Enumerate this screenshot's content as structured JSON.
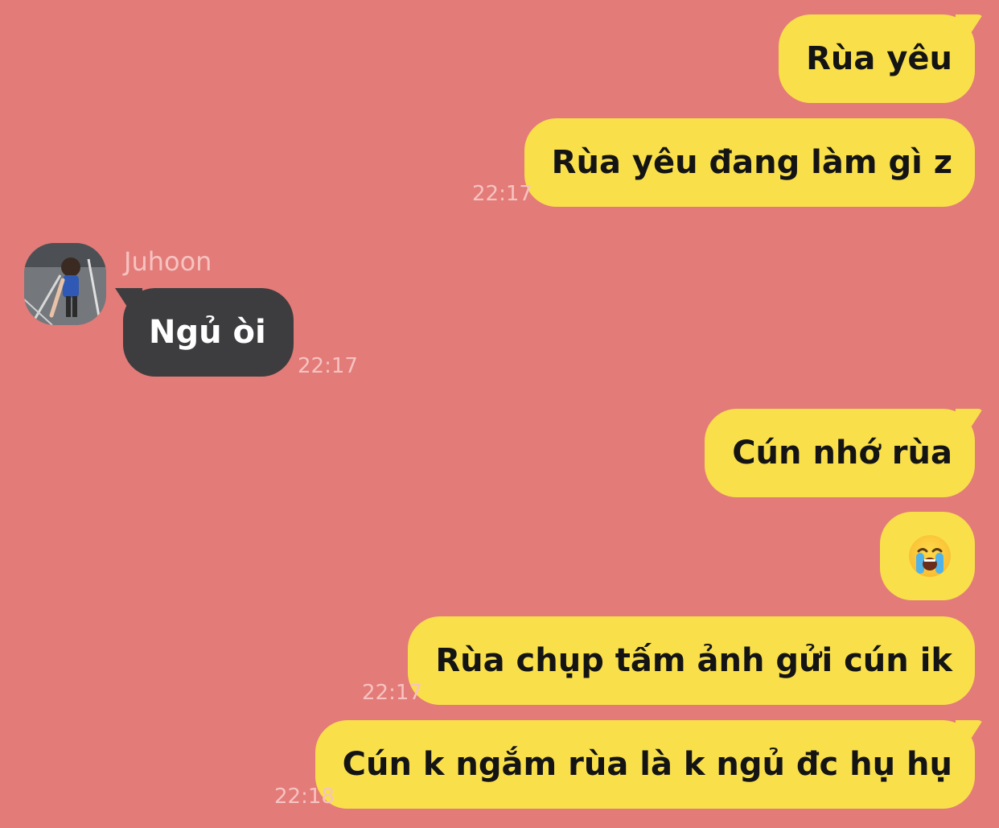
{
  "contact": {
    "name": "Juhoon"
  },
  "messages": [
    {
      "text": "Rùa yêu"
    },
    {
      "text": "Rùa yêu đang làm gì z",
      "time": "22:17"
    },
    {
      "text": "Ngủ òi",
      "time": "22:17"
    },
    {
      "text": "Cún nhớ rùa"
    },
    {
      "text": "😭"
    },
    {
      "text": "Rùa chụp tấm ảnh gửi cún ik",
      "time": "22:17"
    },
    {
      "text": "Cún k ngắm rùa là k ngủ đc hụ hụ",
      "time": "22:18"
    }
  ],
  "colors": {
    "background": "#e37b78",
    "outgoing_bubble": "#f9e04b",
    "incoming_bubble": "#3d3d3f",
    "timestamp": "#f6c3c1"
  },
  "icons": {
    "crying_emoji": "loudly-crying-face-icon"
  }
}
